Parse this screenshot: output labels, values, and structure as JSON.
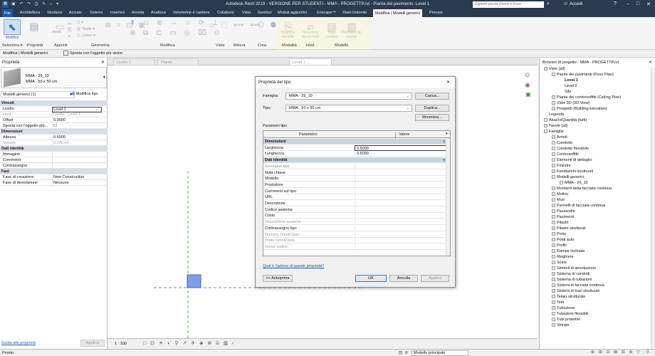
{
  "titlebar": {
    "app_title": "Autodesk Revit 2019 - VERSIONE PER STUDENTI - MMA - PROGETTP.rvt - Pianta del pavimento: Level 1",
    "search_placeholder": "Digitare parola chiave o frase",
    "account": "Accedi"
  },
  "tabs": [
    "File",
    "Architettura",
    "Struttura",
    "Acciaio",
    "Sistemi",
    "Inserisci",
    "Annota",
    "Analizza",
    "Volumetrie e cantiere",
    "Collabora",
    "Vista",
    "Gestisci",
    "Moduli aggiuntivi",
    "Enscape™",
    "Xlam Dolomiti",
    "Modifica | Modelli generici",
    "Precast"
  ],
  "ribbon": {
    "modify_label": "Modifica",
    "involl_label": "Involl.",
    "taglio_label": "Taglio",
    "unisci_label": "Unisci",
    "modify_families_label": "Modifica famiglia",
    "select_host_label": "Seleziona nuovo host",
    "host_label": "Host contigui",
    "mass_label": "Pavimenti di massa",
    "panels": [
      "Seleziona ▾",
      "Proprietà",
      "Appunti",
      "Geometria",
      "Modifica",
      "Vista",
      "Misura",
      "Crea",
      "Modalità",
      "Host",
      "Modello"
    ]
  },
  "optionbar": {
    "context": "Modifica | Modelli generici",
    "checkbox_label": "Sposta con l'oggetto più vicino"
  },
  "properties": {
    "title": "Proprietà",
    "family": "MMA - 26_10",
    "type": "MMA - 50 x 50 cm",
    "filter": "Modelli generici (1)",
    "edit_type": "Modifica tipo",
    "help_link": "Guida alle proprietà",
    "apply": "Applica",
    "rows": [
      {
        "section": "Vincoli"
      },
      {
        "k": "Livello",
        "v": "Level 1"
      },
      {
        "k": "Host",
        "v": "Livello : Level 1",
        "grey": true
      },
      {
        "k": "Offset",
        "v": "0.0000"
      },
      {
        "k": "Sposta con l'oggetto più...",
        "v": "☐"
      },
      {
        "section": "Dimensioni"
      },
      {
        "k": "Altezza",
        "v": "0.5000"
      },
      {
        "k": "Volume",
        "v": "0.125 m³",
        "grey": true
      },
      {
        "section": "Dati identità"
      },
      {
        "k": "Immagine",
        "v": ""
      },
      {
        "k": "Commenti",
        "v": ""
      },
      {
        "k": "Contrassegno",
        "v": ""
      },
      {
        "section": "Fasi"
      },
      {
        "k": "Fase di creazione",
        "v": "New Construction"
      },
      {
        "k": "Fase di demolizione",
        "v": "Nessuno"
      }
    ]
  },
  "viewtabs": [
    "Livello 1",
    "Pianta",
    "Level 1"
  ],
  "viewcontrol": {
    "scale": "1 : 100"
  },
  "browser": {
    "title": "Browser di progetto - MMA - PROGETTP.rvt",
    "items": [
      {
        "t": "Viste (all)",
        "l": 0,
        "e": "-"
      },
      {
        "t": "Piante dei pavimenti (Floor Plan)",
        "l": 1,
        "e": "-"
      },
      {
        "t": "Level 1",
        "l": 2,
        "bold": true
      },
      {
        "t": "Level 2",
        "l": 2
      },
      {
        "t": "Site",
        "l": 2
      },
      {
        "t": "Piante dei controsoffitti (Ceiling Plan)",
        "l": 1,
        "e": "+"
      },
      {
        "t": "Viste 3D (3D View)",
        "l": 1,
        "e": "+"
      },
      {
        "t": "Prospetti (Building Elevation)",
        "l": 1,
        "e": "+"
      },
      {
        "t": "Legende",
        "l": 0
      },
      {
        "t": "Abachi/Quantità (tutti)",
        "l": 0,
        "e": "+"
      },
      {
        "t": "Tavole (all)",
        "l": 0,
        "e": "+"
      },
      {
        "t": "Famiglie",
        "l": 0,
        "e": "-"
      },
      {
        "t": "Arredi",
        "l": 1,
        "e": "+"
      },
      {
        "t": "Condotto",
        "l": 1,
        "e": "+"
      },
      {
        "t": "Condotto flessibile",
        "l": 1,
        "e": "+"
      },
      {
        "t": "Controsoffitti",
        "l": 1,
        "e": "+"
      },
      {
        "t": "Elementi di dettaglio",
        "l": 1,
        "e": "+"
      },
      {
        "t": "Finestre",
        "l": 1,
        "e": "+"
      },
      {
        "t": "Fondazioni strutturali",
        "l": 1,
        "e": "+"
      },
      {
        "t": "Modelli generici",
        "l": 1,
        "e": "-"
      },
      {
        "t": "MMA - 26_10",
        "l": 2,
        "e": "+"
      },
      {
        "t": "Montanti della facciata continua",
        "l": 1,
        "e": "+"
      },
      {
        "t": "Motivo",
        "l": 1,
        "e": "+"
      },
      {
        "t": "Muri",
        "l": 1,
        "e": "+"
      },
      {
        "t": "Pannelli di facciata continua",
        "l": 1,
        "e": "+"
      },
      {
        "t": "Passerelle",
        "l": 1,
        "e": "+"
      },
      {
        "t": "Pavimenti",
        "l": 1,
        "e": "+"
      },
      {
        "t": "Pilastri",
        "l": 1,
        "e": "+"
      },
      {
        "t": "Pilastri strutturali",
        "l": 1,
        "e": "+"
      },
      {
        "t": "Porte",
        "l": 1,
        "e": "+"
      },
      {
        "t": "Posti auto",
        "l": 1,
        "e": "+"
      },
      {
        "t": "Profili",
        "l": 1,
        "e": "+"
      },
      {
        "t": "Rampe inclinate",
        "l": 1,
        "e": "+"
      },
      {
        "t": "Ringhiere",
        "l": 1,
        "e": "+"
      },
      {
        "t": "Scale",
        "l": 1,
        "e": "+"
      },
      {
        "t": "Simboli di annotazione",
        "l": 1,
        "e": "+"
      },
      {
        "t": "Sistema di condotti",
        "l": 1,
        "e": "+"
      },
      {
        "t": "Sistema di tubazioni",
        "l": 1,
        "e": "+"
      },
      {
        "t": "Sistemi di facciata continua",
        "l": 1,
        "e": "+"
      },
      {
        "t": "Sistemi di travi strutturali",
        "l": 1,
        "e": "+"
      },
      {
        "t": "Telaio strutturale",
        "l": 1,
        "e": "+"
      },
      {
        "t": "Tetti",
        "l": 1,
        "e": "+"
      },
      {
        "t": "Tubazione",
        "l": 1,
        "e": "+"
      },
      {
        "t": "Tubazioni flessibili",
        "l": 1,
        "e": "+"
      },
      {
        "t": "Tubi protettivi",
        "l": 1,
        "e": "+"
      },
      {
        "t": "Vetrate",
        "l": 1,
        "e": "+"
      }
    ]
  },
  "status": {
    "left": "Pronto",
    "model": "Modello principale",
    "zero": ":0"
  },
  "dialog": {
    "title": "Proprietà del tipo",
    "family_label": "Famiglia:",
    "family_value": "MMA - 26_10",
    "type_label": "Tipo:",
    "type_value": "MMA - 50 x 50 cm",
    "load_btn": "Carica...",
    "dup_btn": "Duplica...",
    "rename_btn": "Rinomina...",
    "params_label": "Parametri tipo",
    "col_param": "Parametro",
    "col_value": "Valore",
    "rows": [
      {
        "section": "Dimensioni"
      },
      {
        "k": "Larghezza",
        "v": "0.5000",
        "edit": true
      },
      {
        "k": "Lunghezza",
        "v": "0.5000"
      },
      {
        "section": "Dati identità"
      },
      {
        "k": "Immagine tipo",
        "v": "",
        "grey": true
      },
      {
        "k": "Nota chiave",
        "v": ""
      },
      {
        "k": "Modello",
        "v": ""
      },
      {
        "k": "Produttore",
        "v": ""
      },
      {
        "k": "Commenti sul tipo",
        "v": ""
      },
      {
        "k": "URL",
        "v": ""
      },
      {
        "k": "Descrizione",
        "v": ""
      },
      {
        "k": "Codice assieme",
        "v": ""
      },
      {
        "k": "Costo",
        "v": ""
      },
      {
        "k": "Descrizione assieme",
        "v": "",
        "grey": true
      },
      {
        "k": "Contrassegno tipo",
        "v": ""
      },
      {
        "k": "Numero OmniClass",
        "v": "",
        "grey": true
      },
      {
        "k": "Titolo OmniClass",
        "v": "",
        "grey": true
      },
      {
        "k": "Nome codice",
        "v": "",
        "grey": true
      }
    ],
    "help_link": "Qual è l'azione di queste proprietà?",
    "preview_btn": "<< Anteprima",
    "ok_btn": "OK",
    "cancel_btn": "Annulla",
    "apply_btn": "Applica"
  },
  "colors": {
    "ribbon_bg": "#2b3a4e",
    "accent": "#1a5aa8",
    "element_fill": "#7f9ee0",
    "grid_line": "#55b055"
  }
}
